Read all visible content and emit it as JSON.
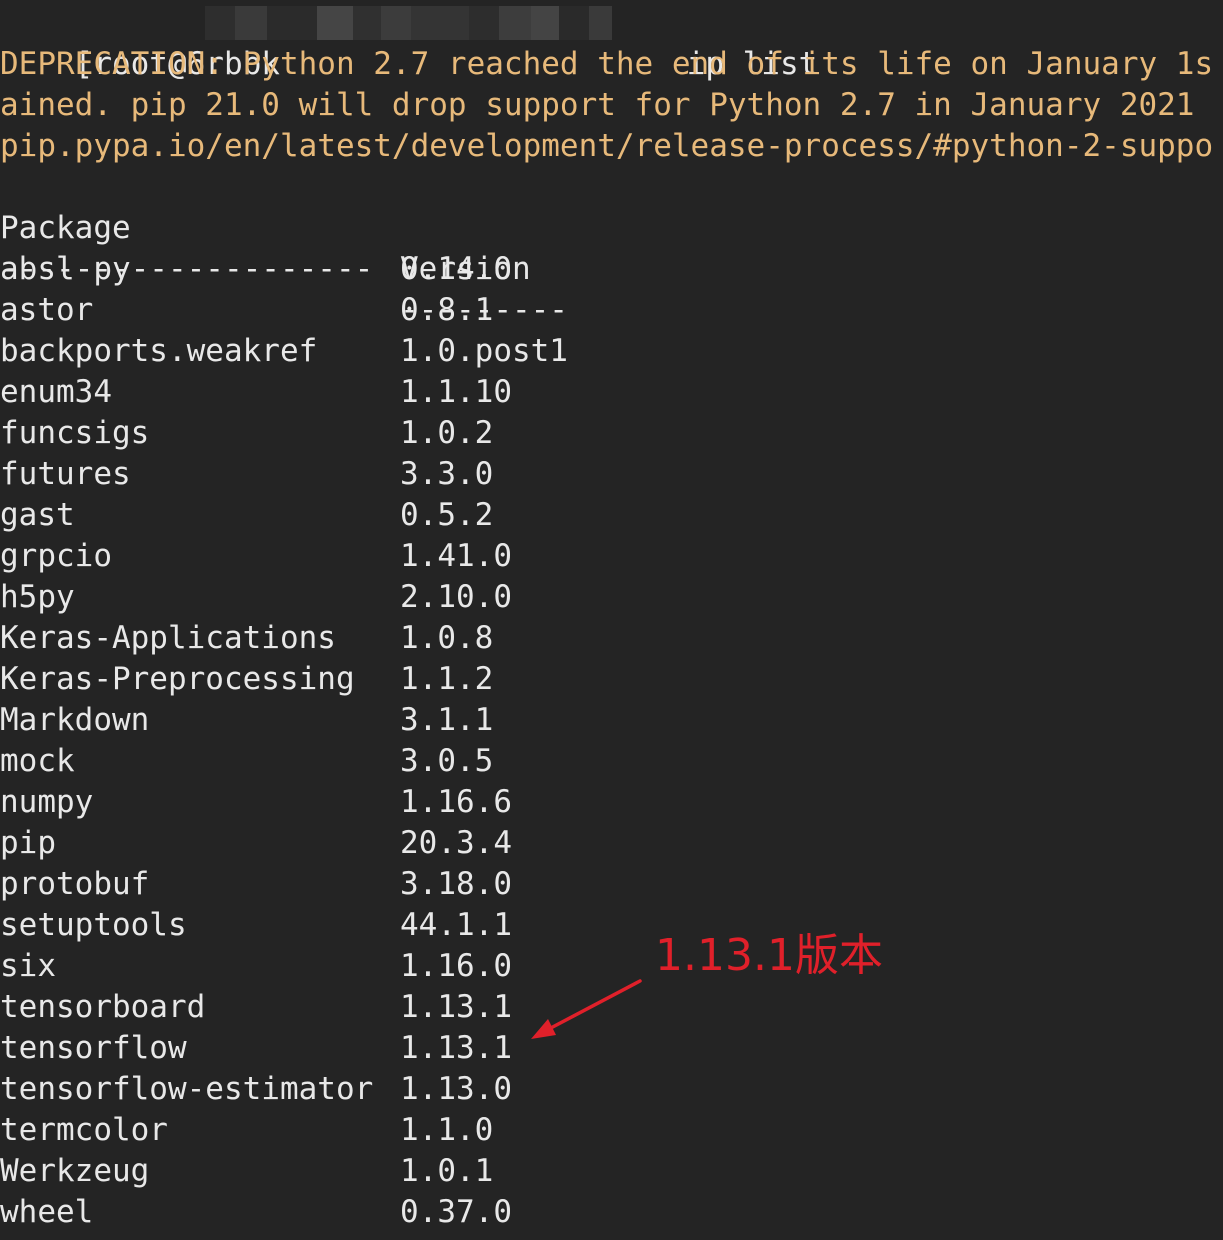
{
  "prompt": {
    "prefix": "[root@6rbbk",
    "command": "ip list"
  },
  "deprecation": {
    "line1": "DEPRECATION: Python 2.7 reached the end of its life on January 1s",
    "line2": "ained. pip 21.0 will drop support for Python 2.7 in January 2021",
    "line3": "pip.pypa.io/en/latest/development/release-process/#python-2-suppo"
  },
  "table": {
    "header_package": "Package",
    "header_version": "Version",
    "sep_package": "--------------------",
    "sep_version": "---------",
    "rows": [
      {
        "name": "absl-py",
        "version": "0.14.0"
      },
      {
        "name": "astor",
        "version": "0.8.1"
      },
      {
        "name": "backports.weakref",
        "version": "1.0.post1"
      },
      {
        "name": "enum34",
        "version": "1.1.10"
      },
      {
        "name": "funcsigs",
        "version": "1.0.2"
      },
      {
        "name": "futures",
        "version": "3.3.0"
      },
      {
        "name": "gast",
        "version": "0.5.2"
      },
      {
        "name": "grpcio",
        "version": "1.41.0"
      },
      {
        "name": "h5py",
        "version": "2.10.0"
      },
      {
        "name": "Keras-Applications",
        "version": "1.0.8"
      },
      {
        "name": "Keras-Preprocessing",
        "version": "1.1.2"
      },
      {
        "name": "Markdown",
        "version": "3.1.1"
      },
      {
        "name": "mock",
        "version": "3.0.5"
      },
      {
        "name": "numpy",
        "version": "1.16.6"
      },
      {
        "name": "pip",
        "version": "20.3.4"
      },
      {
        "name": "protobuf",
        "version": "3.18.0"
      },
      {
        "name": "setuptools",
        "version": "44.1.1"
      },
      {
        "name": "six",
        "version": "1.16.0"
      },
      {
        "name": "tensorboard",
        "version": "1.13.1"
      },
      {
        "name": "tensorflow",
        "version": "1.13.1"
      },
      {
        "name": "tensorflow-estimator",
        "version": "1.13.0"
      },
      {
        "name": "termcolor",
        "version": "1.1.0"
      },
      {
        "name": "Werkzeug",
        "version": "1.0.1"
      },
      {
        "name": "wheel",
        "version": "0.37.0"
      }
    ]
  },
  "annotation": {
    "text": "1.13.1版本",
    "color": "#e0202a"
  },
  "colors": {
    "background": "#242424",
    "text": "#e8e8e8",
    "warning": "#e7b97a"
  }
}
